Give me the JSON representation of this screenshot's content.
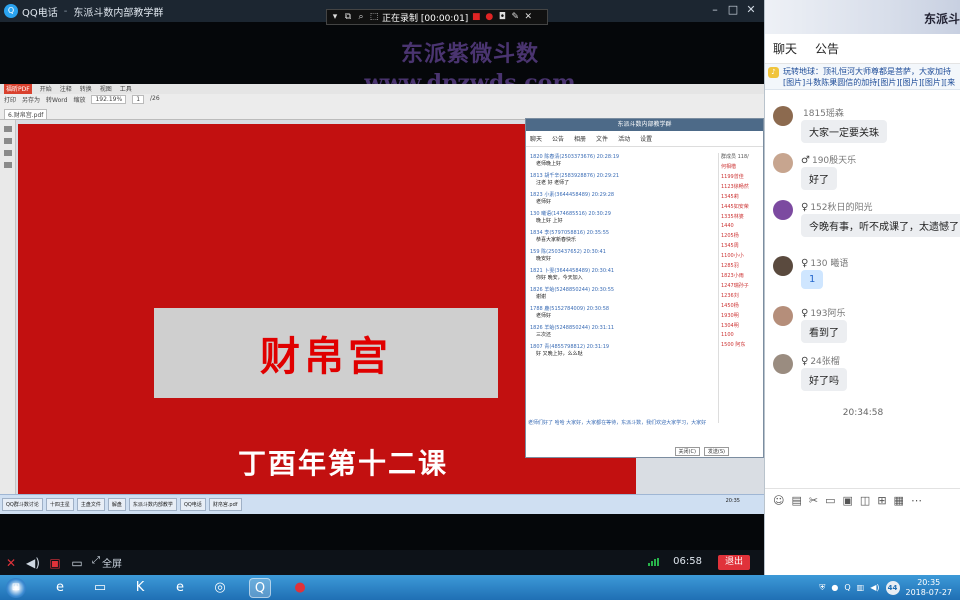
{
  "qq_window": {
    "title": "QQ电话",
    "separator": "-",
    "group_name": "东派斗数内部教学群",
    "controls": [
      "–",
      "□",
      "✕"
    ]
  },
  "recording": {
    "status": "正在录制 [00:00:01]"
  },
  "watermark": {
    "title": "东派紫微斗数",
    "url": "www.dpzwds.com"
  },
  "shared_screen": {
    "pdf_menu": [
      "福昕PDF",
      "开始",
      "注释",
      "转换",
      "视图",
      "工具"
    ],
    "pdf_tools": [
      "打印",
      "另存为",
      "转Word",
      "缩放",
      "192.19%"
    ],
    "pdf_file": "6.财帛宫.pdf",
    "page_input": "1",
    "page_total": "/26",
    "slide": {
      "title": "财帛宫",
      "subtitle": "丁酉年第十二课"
    },
    "inner_chat": {
      "title": "东派斗数内部教学群",
      "tabs": [
        "聊天",
        "公告",
        "相册",
        "文件",
        "活动",
        "设置"
      ],
      "messages": [
        {
          "who": "1820 陈春清(2503373676)  20:28:19",
          "text": "老师晚上好"
        },
        {
          "who": "1813 胡千辛(2583928876)  20:29:21",
          "text": "汪老 好 老师了"
        },
        {
          "who": "1823 小素(3644458489)  20:29:28",
          "text": "老师好"
        },
        {
          "who": "130 曦语(1474685516)  20:30:29",
          "text": "晚上好 上好"
        },
        {
          "who": "1834 李(5797058816)  20:35:55",
          "text": "恭喜大家新春快乐"
        },
        {
          "who": "159 陈(2503437652)  20:30:41",
          "text": "晚安好"
        },
        {
          "who": "1821 卜雯(3644458489)  20:30:41",
          "text": "你好 晚安，今天加入"
        },
        {
          "who": "1826 羊蛤(5248850244)  20:30:55",
          "text": "谢谢"
        },
        {
          "who": "1788 鹿(5152784009)  20:30:58",
          "text": "老师好"
        },
        {
          "who": "1826 羊蛤(5248850244)  20:31:11",
          "text": "三次还"
        },
        {
          "who": "1807 青(4855798812)  20:31:19",
          "text": "好 又晚上好，么么哒"
        }
      ],
      "members_label": "群成员 118/",
      "members": [
        "何相楷",
        "1199曾佳",
        "1123徐畅然",
        "1345莉",
        "1445如安荣",
        "1335林婆",
        "1440",
        "1205杨",
        "1345周",
        "1100小小",
        "1285羽",
        "1823小雨",
        "1247瑞孙子",
        "1236刘",
        "1450杨",
        "1930明",
        "1304明",
        "1100",
        "1500 阿东"
      ],
      "notice": "老师们好了 哈哈 大家好，大家都在等待，东派斗数，我们欢迎大家学习，大家好",
      "buttons": [
        "关闭(C)",
        "发送(S)"
      ]
    },
    "taskbar_items": [
      "QQ群斗数讨论",
      "十四主星",
      "主盘文件",
      "解盘",
      "东派斗数内部教学",
      "QQ电话",
      "财帛宫.pdf"
    ],
    "taskbar_clock": "20:35"
  },
  "call_controls": {
    "fullscreen_label": "全屏",
    "duration": "06:58",
    "exit_label": "退出"
  },
  "chat_panel": {
    "group_name": "东派斗",
    "tabs": [
      "聊天",
      "公告"
    ],
    "pinned_notice": "玩转地球：顶礼恒河大师尊都是菩萨，大家加持[图片]斗数陈果圆信的加持[图片][图片][图片][来自我的]",
    "messages": [
      {
        "nick": "1815瑶森",
        "sex": "",
        "text": "大家一定要关珠",
        "avatar_color": "#8c6a4f"
      },
      {
        "nick": "190殷天乐",
        "sex": "♂",
        "text": "好了",
        "avatar_color": "#c7a58f"
      },
      {
        "nick": "152秋日的阳光",
        "sex": "♀",
        "text": "今晚有事，听不成课了，太遗憾了",
        "avatar_color": "#7c4aa0"
      },
      {
        "nick": "130 曦语",
        "sex": "♀",
        "text": "1",
        "avatar_color": "#5a4a3e"
      },
      {
        "nick": "193阿乐",
        "sex": "♀",
        "text": "看到了",
        "avatar_color": "#b58e7a"
      },
      {
        "nick": "24张榴",
        "sex": "♀",
        "text": "好了吗",
        "avatar_color": "#9a8c80"
      }
    ],
    "time_divider": "20:34:58",
    "input_icons": [
      "emoji-icon",
      "gif-icon",
      "scissors-icon",
      "folder-icon",
      "image-icon",
      "screenshot-icon",
      "gift-icon",
      "calendar-icon",
      "more-icon"
    ]
  },
  "taskbar": {
    "clock_time": "20:35",
    "clock_date": "2018-07-27",
    "badge": "44"
  }
}
